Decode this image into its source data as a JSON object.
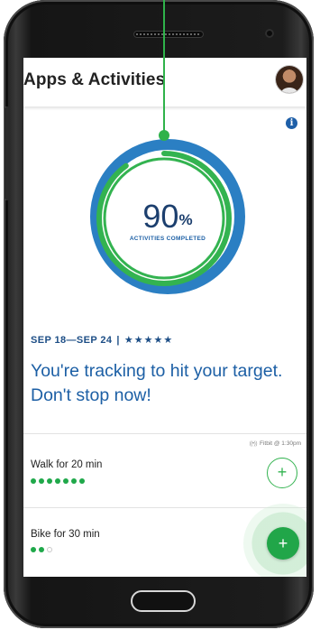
{
  "app": {
    "title": "Apps & Activities"
  },
  "progress": {
    "percent": 90,
    "number_text": "90",
    "symbol": "%",
    "label": "ACTIVITIES COMPLETED"
  },
  "week": {
    "range": "SEP 18—SEP 24",
    "separator": "|",
    "stars": "★★★★★",
    "rating": 5
  },
  "message": "You're tracking to hit your target. Don't stop now!",
  "activities": [
    {
      "title": "Walk for 20 min",
      "dots_filled": 7,
      "dots_total": 7,
      "source_text": "Fitbit @ 1:30pm",
      "source_signal": "((•))"
    },
    {
      "title": "Bike for 30 min",
      "dots_filled": 2,
      "dots_total": 3
    }
  ],
  "icons": {
    "info": "info-icon",
    "add": "plus-icon",
    "signal": "broadcast-icon"
  },
  "colors": {
    "brand_blue": "#1c5fa5",
    "ring_blue": "#2b7fc3",
    "ring_green": "#33b350",
    "accent_green": "#21a649"
  }
}
